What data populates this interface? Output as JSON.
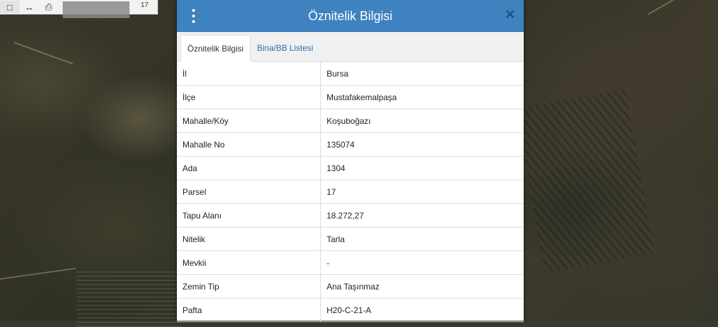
{
  "toolbar": {
    "icons": [
      "move-horizontal-icon",
      "print-icon"
    ],
    "value": "17"
  },
  "modal": {
    "title": "Öznitelik Bilgisi",
    "tabs": [
      {
        "label": "Öznitelik Bilgisi",
        "active": true
      },
      {
        "label": "Bina/BB Listesi",
        "active": false
      }
    ],
    "rows": [
      {
        "key": "İl",
        "value": "Bursa"
      },
      {
        "key": "İlçe",
        "value": "Mustafakemalpaşa"
      },
      {
        "key": "Mahalle/Köy",
        "value": "Koşuboğazı"
      },
      {
        "key": "Mahalle No",
        "value": "135074"
      },
      {
        "key": "Ada",
        "value": "1304"
      },
      {
        "key": "Parsel",
        "value": "17"
      },
      {
        "key": "Tapu Alanı",
        "value": "18.272,27"
      },
      {
        "key": "Nitelik",
        "value": "Tarla"
      },
      {
        "key": "Mevkii",
        "value": "-"
      },
      {
        "key": "Zemin Tip",
        "value": "Ana Taşınmaz"
      },
      {
        "key": "Pafta",
        "value": "H20-C-21-A"
      }
    ]
  },
  "colors": {
    "header": "#3e82c0",
    "link": "#2a6fb0"
  }
}
